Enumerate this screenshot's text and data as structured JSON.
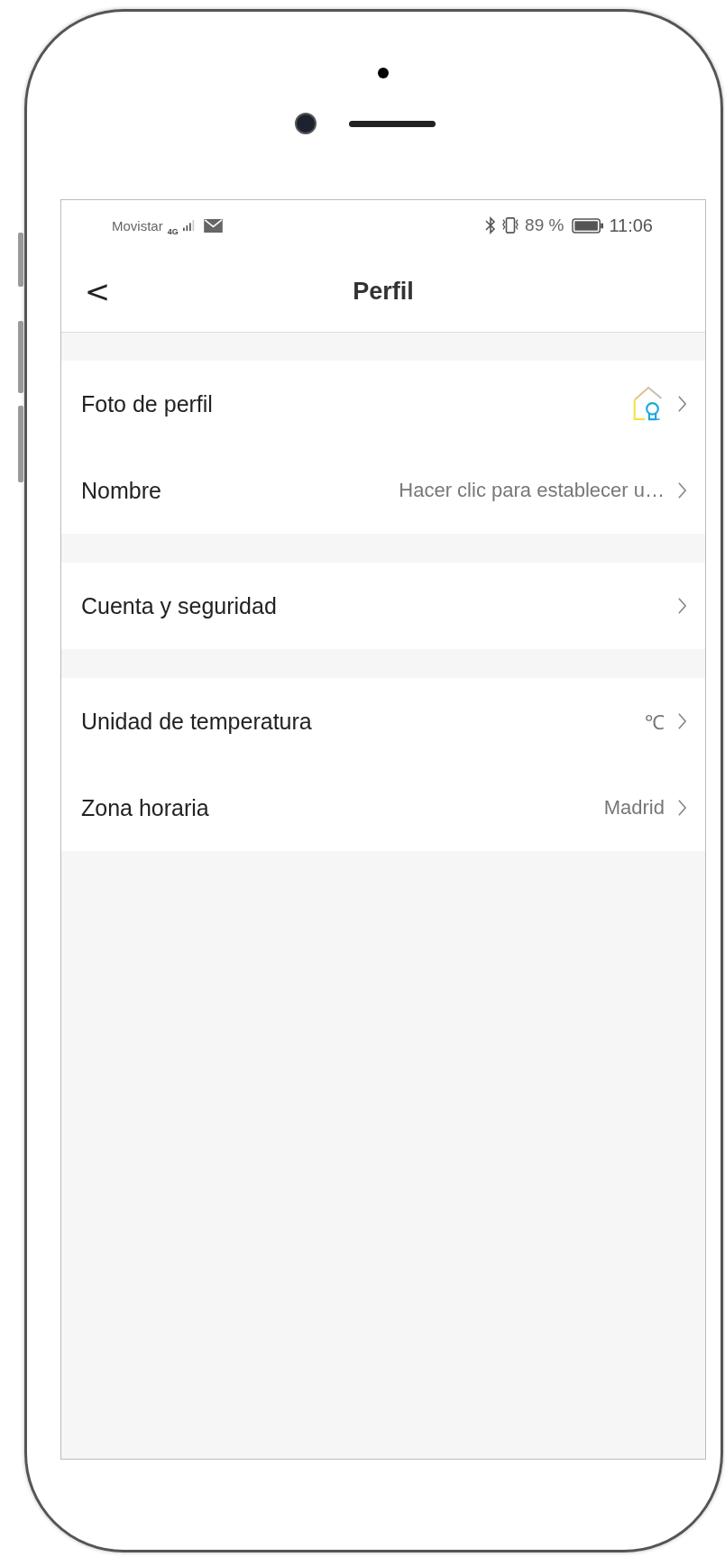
{
  "status_bar": {
    "carrier": "Movistar",
    "network": "4G",
    "battery_percent": "89 %",
    "time": "11:06"
  },
  "header": {
    "back": "<",
    "title": "Perfil"
  },
  "groups": [
    {
      "rows": [
        {
          "kind": "avatar",
          "label": "Foto de perfil"
        },
        {
          "kind": "text",
          "label": "Nombre",
          "value": "Hacer clic para establecer u…"
        }
      ]
    },
    {
      "rows": [
        {
          "kind": "plain",
          "label": "Cuenta y seguridad"
        }
      ]
    },
    {
      "rows": [
        {
          "kind": "text",
          "label": "Unidad de temperatura",
          "value": "℃"
        },
        {
          "kind": "text",
          "label": "Zona horaria",
          "value": "Madrid"
        }
      ]
    }
  ]
}
